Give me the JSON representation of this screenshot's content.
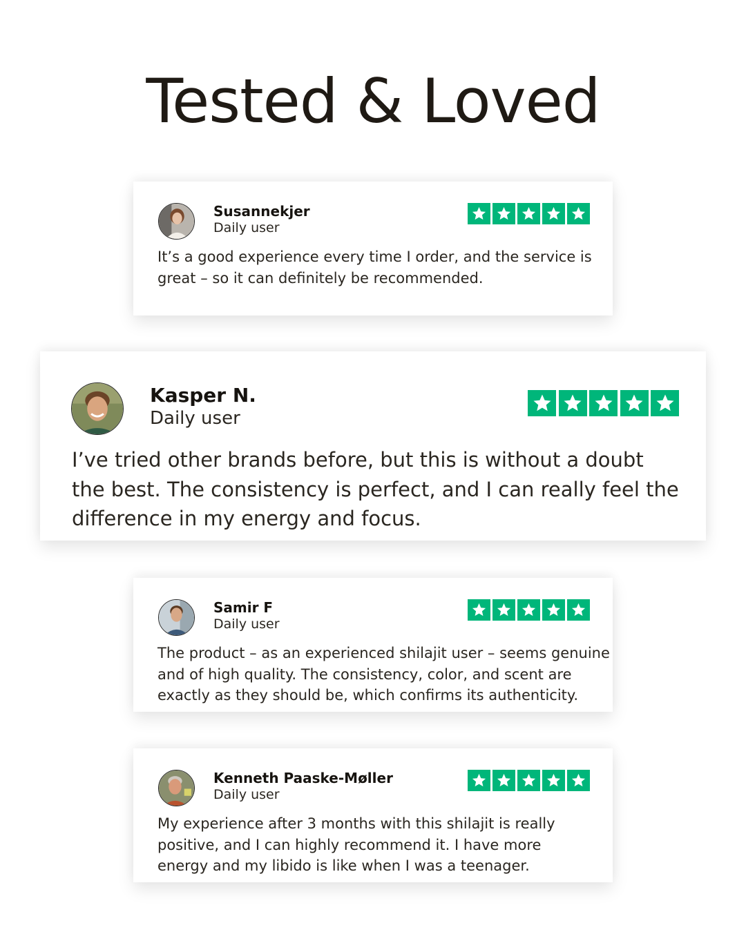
{
  "headline": "Tested & Loved",
  "rating_color": "#00b67a",
  "reviews": [
    {
      "name": "Susannekjer",
      "role": "Daily user",
      "rating": 5,
      "avatar": "woman-portrait",
      "text": "It’s a good experience every time I order, and the service is great – so it can definitely be recommended."
    },
    {
      "name": "Kasper N.",
      "role": "Daily user",
      "rating": 5,
      "avatar": "smiling-man-portrait",
      "text": "I’ve tried other brands before, but this is without a doubt the best. The consistency is perfect, and I can really feel the difference in my energy and focus."
    },
    {
      "name": "Samir F",
      "role": "Daily user",
      "rating": 5,
      "avatar": "man-portrait",
      "text": "The product – as an experienced shilajit user – seems genuine and of high quality. The consistency, color, and scent are exactly as they should be, which confirms its authenticity."
    },
    {
      "name": "Kenneth Paaske-Møller",
      "role": "Daily user",
      "rating": 5,
      "avatar": "older-man-portrait",
      "text": "My experience after 3 months with this shilajit is really positive, and I can highly recommend it. I have more energy and my libido is like when I was a teenager."
    }
  ]
}
